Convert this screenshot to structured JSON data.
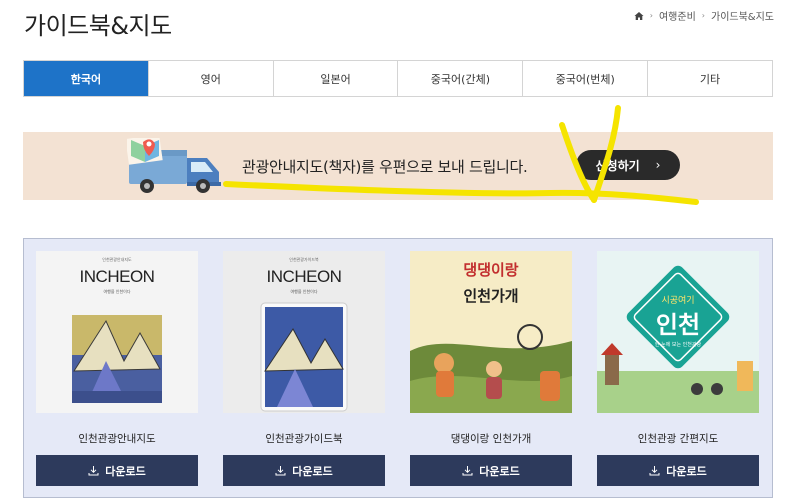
{
  "page": {
    "title": "가이드북&지도"
  },
  "breadcrumb": {
    "items": [
      "여행준비",
      "가이드북&지도"
    ]
  },
  "tabs": [
    {
      "label": "한국어",
      "active": true
    },
    {
      "label": "영어",
      "active": false
    },
    {
      "label": "일본어",
      "active": false
    },
    {
      "label": "중국어(간체)",
      "active": false
    },
    {
      "label": "중국어(번체)",
      "active": false
    },
    {
      "label": "기타",
      "active": false
    }
  ],
  "banner": {
    "text": "관광안내지도(책자)를 우편으로 보내 드립니다.",
    "button_label": "신청하기",
    "button_arrow": "›"
  },
  "cards": [
    {
      "title": "인천관광안내지도",
      "download_label": "다운로드",
      "cover": {
        "sub": "인천관광안내지도",
        "heading": "INCHEON",
        "caption": "여행을 인천이다"
      }
    },
    {
      "title": "인천관광가이드북",
      "download_label": "다운로드",
      "cover": {
        "sub": "인천관광가이드북",
        "heading": "INCHEON",
        "caption": "여행을 인천이다"
      }
    },
    {
      "title": "댕댕이랑 인천가개",
      "download_label": "다운로드",
      "cover": {
        "line1": "댕댕이랑",
        "line2": "인천가개"
      }
    },
    {
      "title": "인천관광 간편지도",
      "download_label": "다운로드",
      "cover": {
        "script": "시공여기",
        "heading": "인천",
        "caption": "한 눈에 보는 인천관광"
      }
    }
  ],
  "colors": {
    "tab_active": "#1e73c8",
    "banner_bg": "#f3e2d3",
    "button_dark": "#2a2a2a",
    "download_btn": "#2d3a5c",
    "cards_bg": "#e5e9f7",
    "highlight": "#f5e400"
  }
}
